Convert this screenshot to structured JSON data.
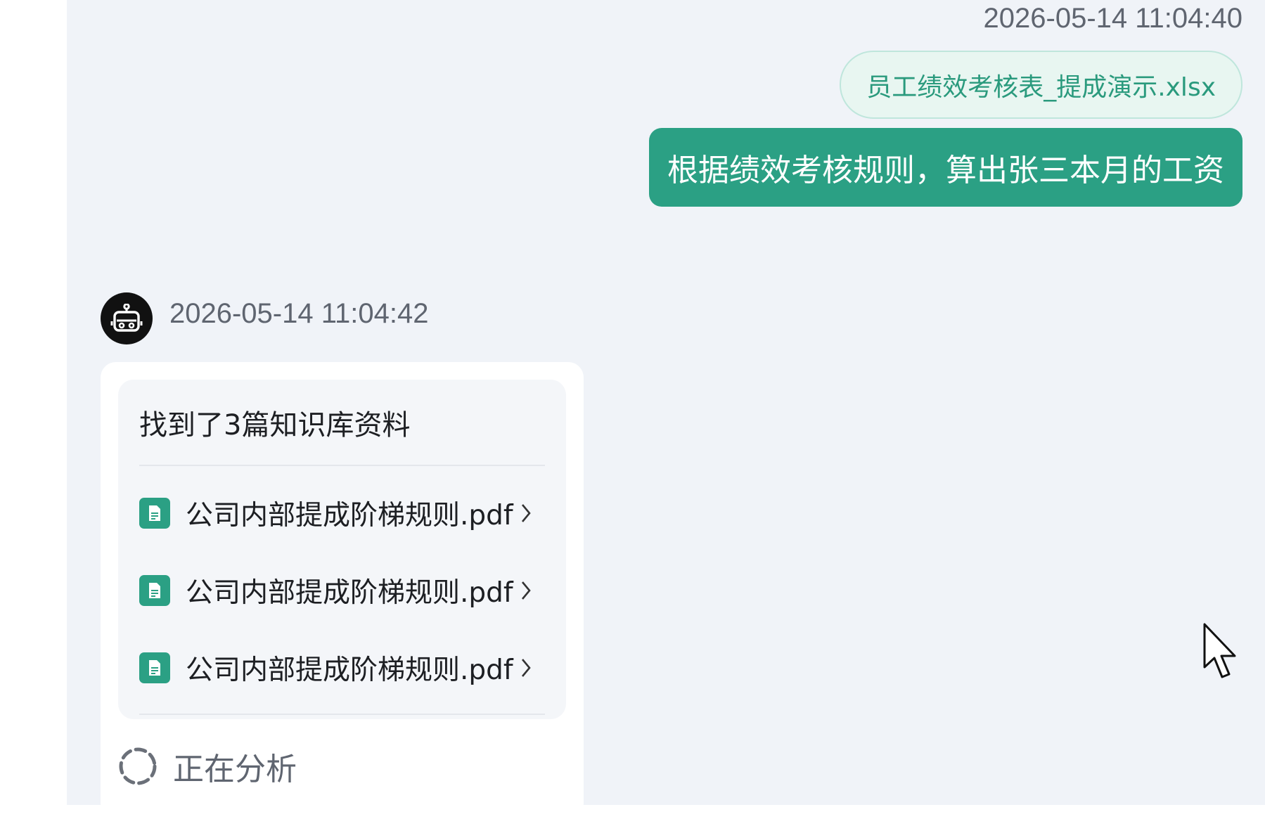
{
  "user_message": {
    "timestamp": "2026-05-14 11:04:40",
    "attachment_name": "员工绩效考核表_提成演示.xlsx",
    "text": "根据绩效考核规则，算出张三本月的工资"
  },
  "bot_message": {
    "timestamp": "2026-05-14 11:04:42",
    "avatar_icon": "robot-icon",
    "knowledge_panel": {
      "title": "找到了3篇知识库资料",
      "items": [
        {
          "label": "公司内部提成阶梯规则.pdf",
          "icon": "document-icon"
        },
        {
          "label": "公司内部提成阶梯规则.pdf",
          "icon": "document-icon"
        },
        {
          "label": "公司内部提成阶梯规则.pdf",
          "icon": "document-icon"
        }
      ]
    },
    "status_text": "正在分析"
  },
  "colors": {
    "accent": "#2ba084",
    "chat_background": "#f0f3f8",
    "chip_background": "#e8f6f1"
  }
}
